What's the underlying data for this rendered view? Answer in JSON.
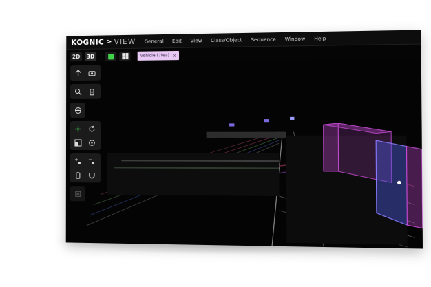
{
  "app": {
    "brand": "KOGNIC",
    "product": "VIEW"
  },
  "menu": {
    "items": [
      "General",
      "Edit",
      "View",
      "Class/Object",
      "Sequence",
      "Window",
      "Help"
    ]
  },
  "toolbar": {
    "mode_2d": "2D",
    "mode_3d": "3D",
    "selected_object_tag": "Vehicle (7fea)",
    "tag_close": "×"
  },
  "icons": {
    "colors": {
      "green": "#41d34a",
      "tag_bg": "#e8c9f3",
      "box_pink": "#c84bd6",
      "box_blue": "#4a57d8"
    }
  }
}
